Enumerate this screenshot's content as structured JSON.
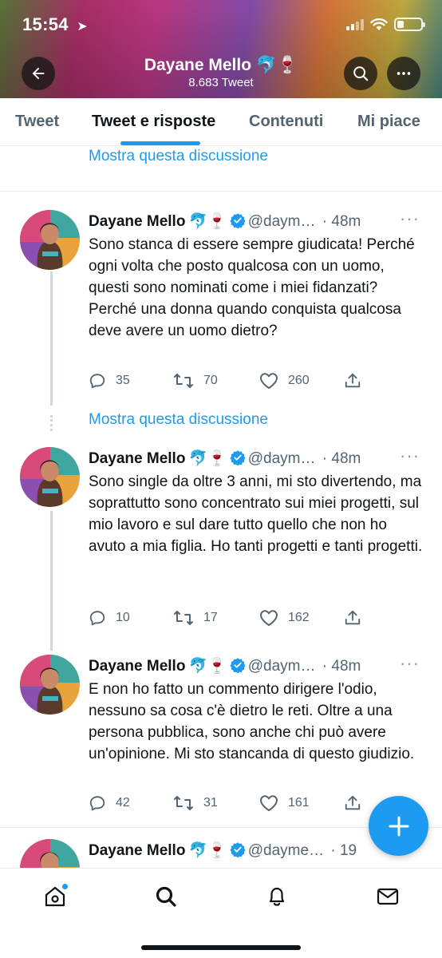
{
  "status_bar": {
    "time": "15:54",
    "location_arrow": "➤"
  },
  "header": {
    "name": "Dayane Mello 🐬🍷",
    "tweet_count": "8.683 Tweet",
    "back_icon": "arrow-left-icon",
    "search_icon": "search-icon",
    "more_icon": "more-horizontal-icon"
  },
  "tabs": [
    {
      "label": "Tweet"
    },
    {
      "label": "Tweet e risposte",
      "active": true
    },
    {
      "label": "Contenuti"
    },
    {
      "label": "Mi piace"
    }
  ],
  "show_thread_label": "Mostra questa discussione",
  "tweets": [
    {
      "name": "Dayane Mello",
      "emoji": "🐬🍷",
      "handle": "@daym…",
      "time": "· 48m",
      "text": "Sono stanca di essere sempre giudicata! Perché ogni volta che posto qualcosa con un uomo, questi sono nominati come i miei fidanzati? Perché una donna quando conquista qualcosa deve avere un uomo dietro?",
      "replies": "35",
      "retweets": "70",
      "likes": "260"
    },
    {
      "name": "Dayane Mello",
      "emoji": "🐬🍷",
      "handle": "@daym…",
      "time": "· 48m",
      "text": "Sono single da oltre 3 anni, mi sto divertendo, ma soprattutto sono concentrato sui miei progetti, sul mio lavoro e sul dare tutto quello che non ho avuto a mia figlia. Ho tanti progetti e tanti progetti.",
      "replies": "10",
      "retweets": "17",
      "likes": "162"
    },
    {
      "name": "Dayane Mello",
      "emoji": "🐬🍷",
      "handle": "@daym…",
      "time": "· 48m",
      "text": "E non ho fatto un commento dirigere l'odio, nessuno sa cosa c'è dietro le reti. Oltre a una persona pubblica, sono anche chi può avere un'opinione. Mi sto stancanda di questo giudizio.",
      "replies": "42",
      "retweets": "31",
      "likes": "161"
    },
    {
      "name": "Dayane Mello",
      "emoji": "🐬🍷",
      "handle": "@dayme…",
      "time": "· 19"
    }
  ],
  "bottom_nav": [
    "home-icon",
    "search-icon",
    "notifications-icon",
    "messages-icon"
  ],
  "colors": {
    "accent": "#1d9bf0",
    "text": "#0f1419",
    "muted": "#536471"
  }
}
